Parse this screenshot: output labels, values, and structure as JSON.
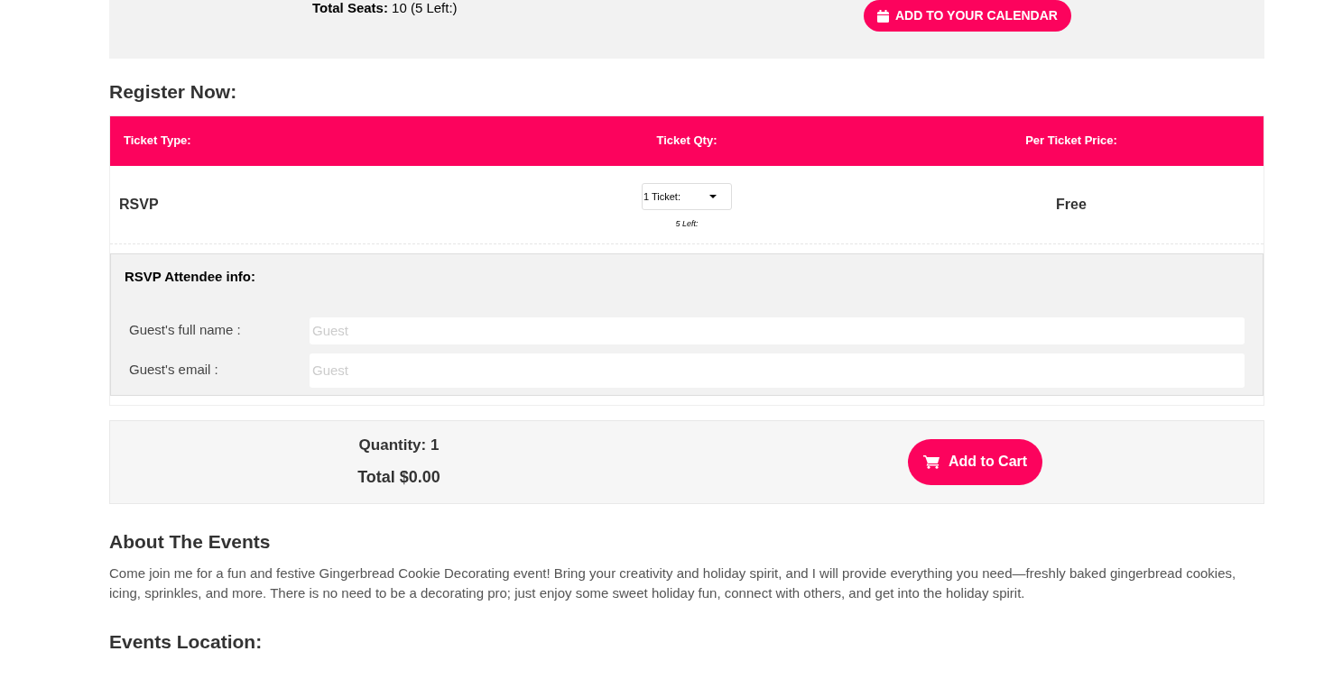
{
  "event_summary": {
    "seats": "**Total Seats:** 10 (5 Left:)",
    "calendar_button": "ADD TO YOUR CALENDAR"
  },
  "register": {
    "heading": "Register Now:",
    "columns": [
      "Ticket Type:",
      "Ticket Qty:",
      "Per Ticket Price:"
    ],
    "rows": [
      {
        "type": "RSVP",
        "qty": "1 Ticket:",
        "left": "5 Left:",
        "price": "Free"
      }
    ],
    "attendee": {
      "heading": "RSVP Attendee info:",
      "fields": [
        {
          "label": "Guest's full name :",
          "placeholder": "Guest"
        },
        {
          "label": "Guest's email :",
          "placeholder": "Guest"
        }
      ]
    }
  },
  "cart": {
    "quantity": "Quantity: 1",
    "total": "Total $0.00",
    "button": "Add to Cart"
  },
  "about": {
    "heading": "About The Events",
    "text": "Come join me for a fun and festive Gingerbread Cookie Decorating event! Bring your creativity and holiday spirit, and I will provide everything you need—freshly baked gingerbread cookies, icing, sprinkles, and more. There is no need to be a decorating pro; just enjoy some sweet holiday fun, connect with others, and get into the holiday spirit."
  },
  "location": {
    "heading": "Events Location:"
  }
}
